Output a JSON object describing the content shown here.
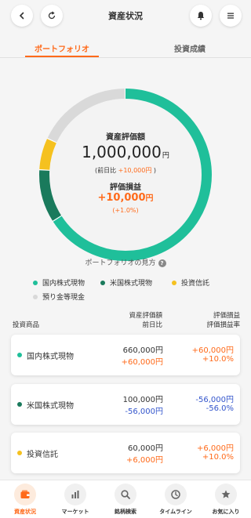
{
  "header": {
    "title": "資産状況"
  },
  "tabs": [
    {
      "label": "ポートフォリオ"
    },
    {
      "label": "投資成績"
    }
  ],
  "summary": {
    "label": "資産評価額",
    "value": "1,000,000",
    "unit": "円",
    "diff_prefix": "(前日比",
    "diff_value": "+10,000円",
    "diff_suffix": ")",
    "pl_label": "評価損益",
    "pl_value": "+10,000",
    "pl_unit": "円",
    "pl_rate": "(+1.0%)"
  },
  "chart_data": {
    "type": "pie",
    "variant": "donut",
    "labels": [
      "国内株式現物",
      "米国株式現物",
      "投資信託",
      "預り金等現金"
    ],
    "values": [
      66,
      10,
      6,
      18
    ],
    "colors": [
      "#1fbf9a",
      "#1a7a5c",
      "#f5c11f",
      "#d9d9d9"
    ]
  },
  "guide": {
    "label": "ポートフォリオの見方",
    "help": "?"
  },
  "legend": [
    {
      "label": "国内株式現物",
      "color": "#1fbf9a"
    },
    {
      "label": "米国株式現物",
      "color": "#1a7a5c"
    },
    {
      "label": "投資信託",
      "color": "#f5c11f"
    },
    {
      "label": "預り金等現金",
      "color": "#d9d9d9"
    }
  ],
  "columns": {
    "product": "投資商品",
    "value_line1": "資産評価額",
    "value_line2": "前日比",
    "pl_line1": "評価損益",
    "pl_line2": "評価損益率"
  },
  "holdings": [
    {
      "name": "国内株式現物",
      "color": "#1fbf9a",
      "value": "660,000円",
      "diff": "+60,000円",
      "pl": "+60,000円",
      "rate": "+10.0%"
    },
    {
      "name": "米国株式現物",
      "color": "#1a7a5c",
      "value": "100,000円",
      "diff": "-56,000円",
      "pl": "-56,000円",
      "rate": "-56.0%"
    },
    {
      "name": "投資信託",
      "color": "#f5c11f",
      "value": "60,000円",
      "diff": "+6,000円",
      "pl": "+6,000円",
      "rate": "+10.0%"
    }
  ],
  "nav": [
    {
      "label": "資産状況",
      "icon": "wallet-icon"
    },
    {
      "label": "マーケット",
      "icon": "bar-chart-icon"
    },
    {
      "label": "銘柄検索",
      "icon": "search-icon"
    },
    {
      "label": "タイムライン",
      "icon": "clock-icon"
    },
    {
      "label": "お気に入り",
      "icon": "star-icon"
    }
  ]
}
